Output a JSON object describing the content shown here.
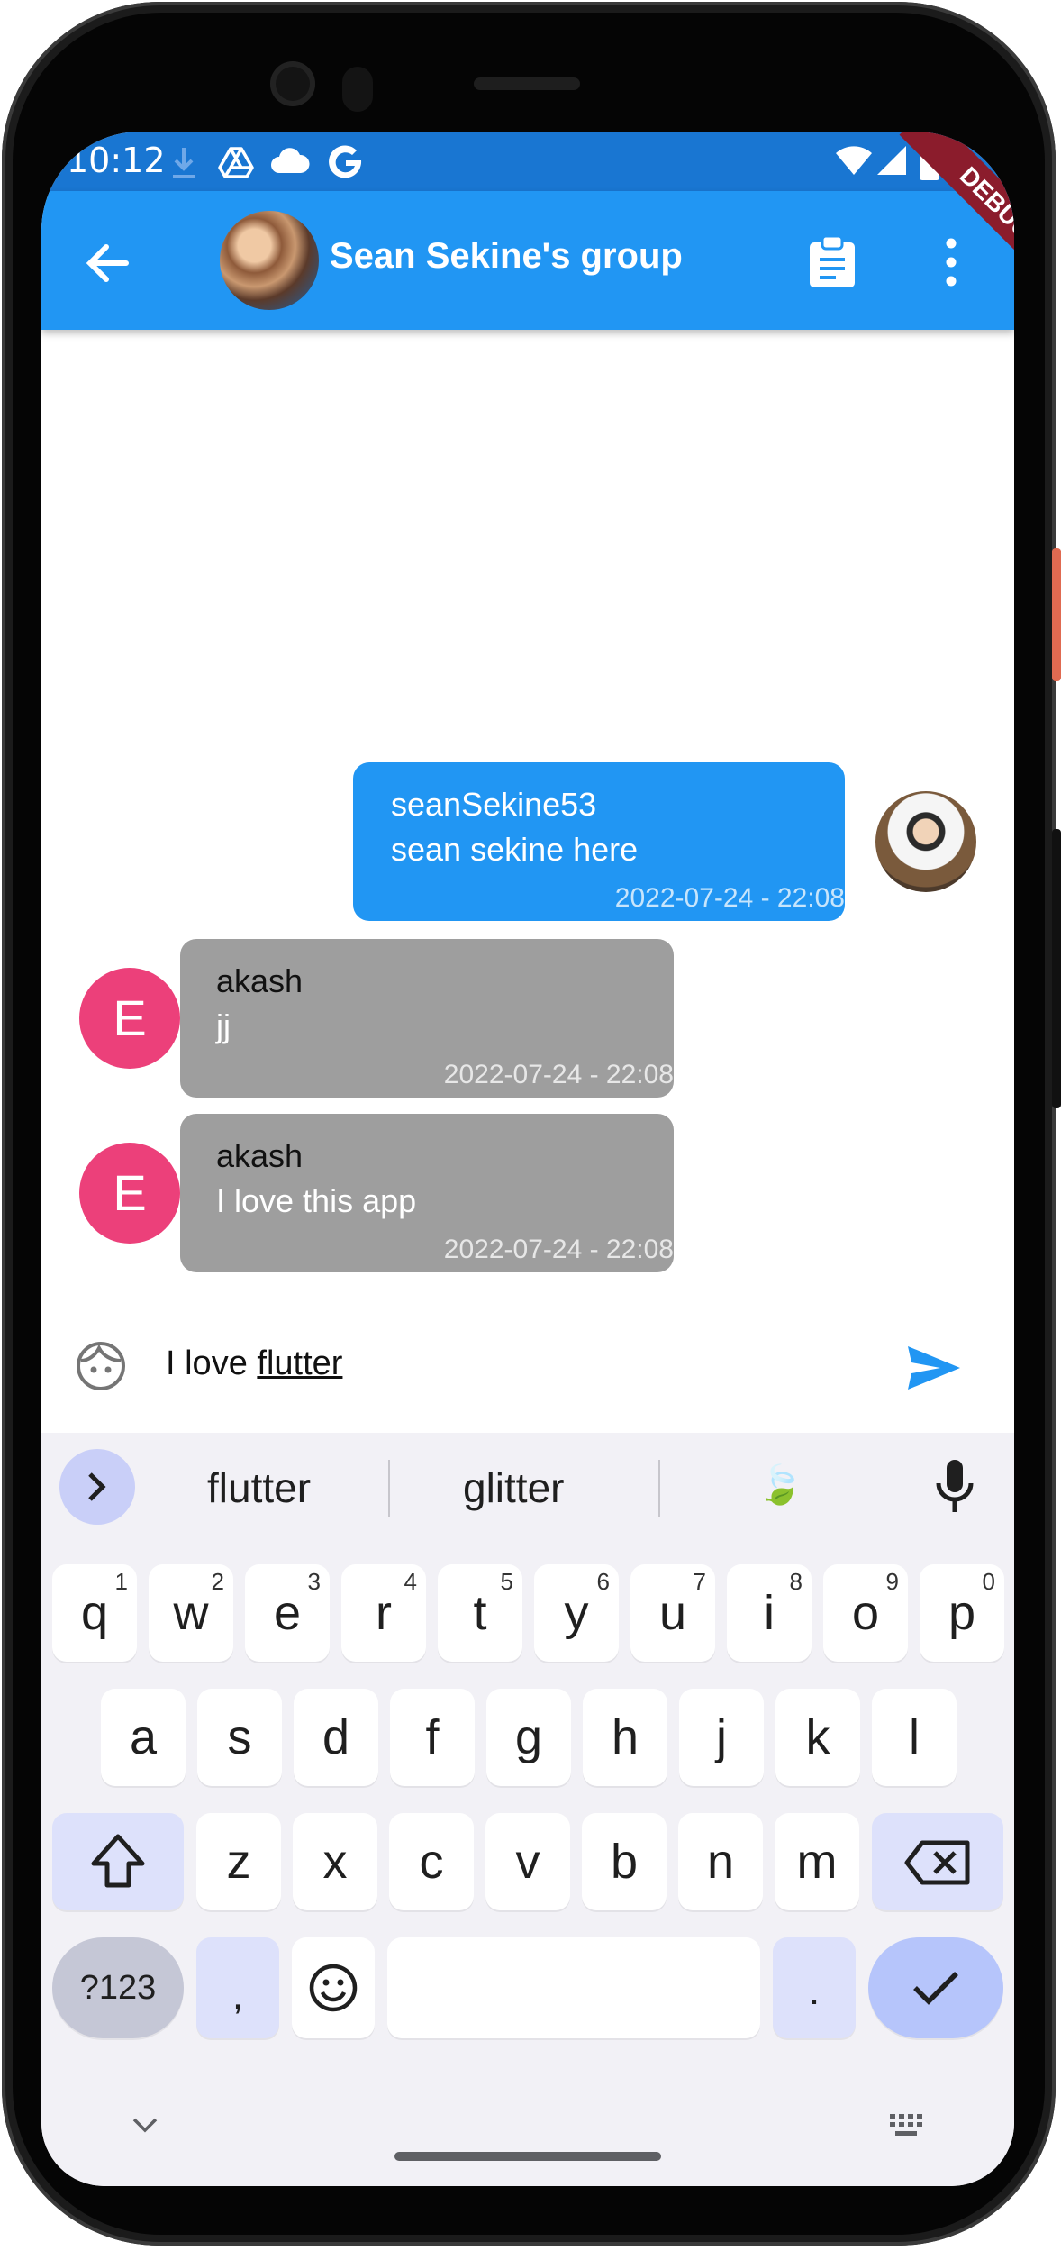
{
  "status_bar": {
    "time": "10:12",
    "icons": [
      "download-icon",
      "drive-icon",
      "cloud-icon",
      "google-g-icon",
      "wifi-icon",
      "signal-icon",
      "battery-icon"
    ]
  },
  "debug_banner": "DEBUG",
  "appbar": {
    "title": "Sean Sekine's group",
    "color": "#2196f3"
  },
  "messages": [
    {
      "sender": "seanSekine53",
      "text": "sean sekine here",
      "time": "2022-07-24 - 22:08",
      "side": "right",
      "bubble_color": "#2196f3",
      "avatar": "photo"
    },
    {
      "sender": "akash",
      "text": "jj",
      "time": "2022-07-24 - 22:08",
      "side": "left",
      "bubble_color": "#9e9e9e",
      "avatar_letter": "E"
    },
    {
      "sender": "akash",
      "text": "I love this app",
      "time": "2022-07-24 - 22:08",
      "side": "left",
      "bubble_color": "#9e9e9e",
      "avatar_letter": "E"
    }
  ],
  "composer": {
    "text_plain": "I love ",
    "text_underlined": "flutter"
  },
  "keyboard": {
    "suggestions": [
      "flutter",
      "glitter"
    ],
    "suggestion_emoji": "🍃",
    "row1": [
      {
        "k": "q",
        "s": "1"
      },
      {
        "k": "w",
        "s": "2"
      },
      {
        "k": "e",
        "s": "3"
      },
      {
        "k": "r",
        "s": "4"
      },
      {
        "k": "t",
        "s": "5"
      },
      {
        "k": "y",
        "s": "6"
      },
      {
        "k": "u",
        "s": "7"
      },
      {
        "k": "i",
        "s": "8"
      },
      {
        "k": "o",
        "s": "9"
      },
      {
        "k": "p",
        "s": "0"
      }
    ],
    "row2": [
      "a",
      "s",
      "d",
      "f",
      "g",
      "h",
      "j",
      "k",
      "l"
    ],
    "row3": [
      "z",
      "x",
      "c",
      "v",
      "b",
      "n",
      "m"
    ],
    "num_key": "?123",
    "comma_key": ",",
    "period_key": "."
  }
}
